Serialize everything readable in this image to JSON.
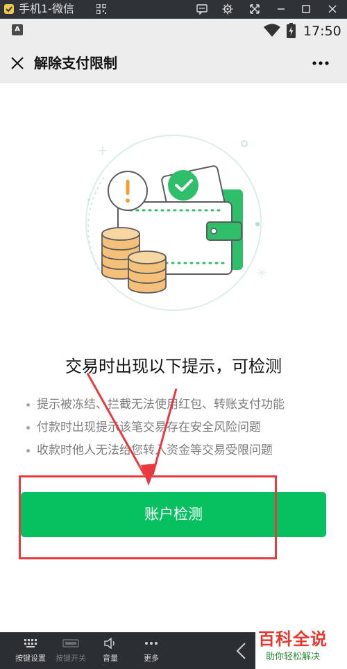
{
  "emulator": {
    "title": "手机1-微信",
    "toolbar": [
      {
        "label": "按键设置",
        "icon": "keyboard-icon"
      },
      {
        "label": "按键开关",
        "icon": "key-toggle-icon"
      },
      {
        "label": "音量",
        "icon": "volume-icon"
      },
      {
        "label": "更多",
        "icon": "more-dots-icon"
      }
    ]
  },
  "status_bar": {
    "notification_badge": "A",
    "time": "17:50"
  },
  "nav": {
    "title": "解除支付限制"
  },
  "content": {
    "headline": "交易时出现以下提示，可检测",
    "bullets": [
      "提示被冻结、拦截无法使用红包、转账支付功能",
      "付款时出现提示该笔交易存在安全风险问题",
      "收款时他人无法给您转入资金等交易受限问题"
    ],
    "action_button": "账户检测"
  },
  "watermark": {
    "brand": "百科全说",
    "slogan": "助你轻松解决"
  },
  "colors": {
    "accent": "#07c160",
    "highlight": "#e8393f",
    "coin": "#f5c07a",
    "alert": "#f0a030"
  }
}
